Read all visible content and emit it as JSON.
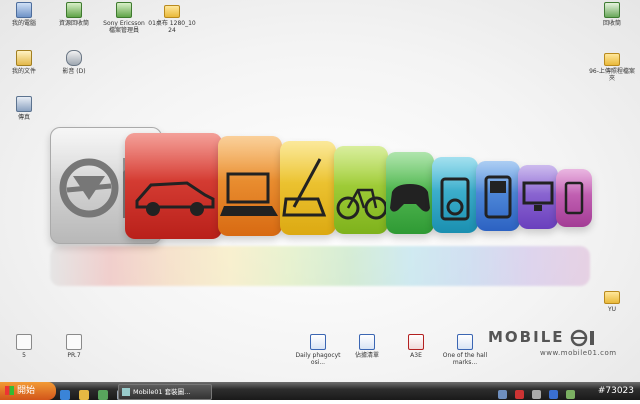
{
  "desktop": {
    "icons_left_top": [
      {
        "label": "我的電腦",
        "icon": "computer-icon"
      },
      {
        "label": "資源回收筒",
        "icon": "network-icon"
      },
      {
        "label": "Sony Ericsson 檔案管理員",
        "icon": "phone-manager-icon"
      },
      {
        "label": "01桌布 1280_1024",
        "icon": "folder-icon"
      }
    ],
    "icons_left_mid": [
      {
        "label": "我的文件",
        "icon": "folder-doc-icon"
      },
      {
        "label": "影音 (D)",
        "icon": "cd-drive-icon"
      },
      {
        "label": "傳真",
        "icon": "fax-icon"
      }
    ],
    "icons_right": [
      {
        "label": "回收筒",
        "icon": "recycle-bin-icon"
      },
      {
        "label": "96-上傳照程檔案夾",
        "icon": "folder-icon"
      },
      {
        "label": "YU",
        "icon": "folder-icon"
      }
    ],
    "icons_bottom": [
      {
        "label": "5",
        "icon": "doc-icon"
      },
      {
        "label": "PR.7",
        "icon": "doc-icon"
      },
      {
        "label": "Daily phagocytosi...",
        "icon": "word-doc-icon"
      },
      {
        "label": "佔據清單",
        "icon": "word-doc-icon"
      },
      {
        "label": "A3E",
        "icon": "pdf-icon"
      },
      {
        "label": "One of the hallmarks...",
        "icon": "word-doc-icon"
      }
    ],
    "wallpaper": {
      "brand": "MOBILE",
      "url": "www.mobile01.com",
      "tiles": [
        "#bfbfbf",
        "#d9322c",
        "#ef8a1f",
        "#f2c21a",
        "#9bcc2a",
        "#49b649",
        "#2aa9c6",
        "#3d85d6",
        "#7a4fc4",
        "#b94aa8"
      ]
    }
  },
  "taskbar": {
    "start_label": "開始",
    "task_label": "Mobile01 套裝圖...",
    "clock": "#73023"
  }
}
